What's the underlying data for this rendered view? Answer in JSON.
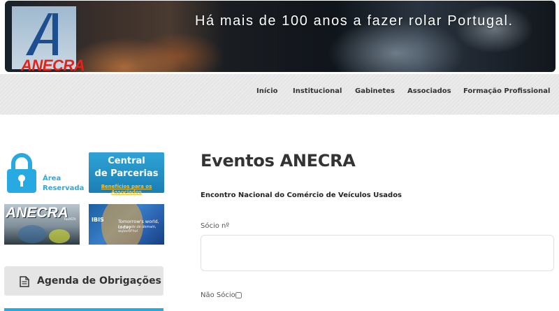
{
  "header": {
    "logo_text": "ANECRA",
    "slogan": "Há mais de 100 anos a fazer rolar Portugal."
  },
  "nav": {
    "items": [
      {
        "label": "Início"
      },
      {
        "label": "Institucional"
      },
      {
        "label": "Gabinetes"
      },
      {
        "label": "Associados"
      },
      {
        "label": "Formação Profissional"
      }
    ]
  },
  "sidebar": {
    "area_reservada": {
      "line1": "Área",
      "line2": "Reservada",
      "icon": "lock-icon"
    },
    "central_parcerias": {
      "line1": "Central",
      "line2": "de Parcerias",
      "tagline": "Benefícios para os Associados"
    },
    "revista": {
      "title": "ANECRA",
      "subtitle": "REVISTA"
    },
    "ibis": {
      "brand": "IBIS",
      "text1": "Tomorrow's world, today",
      "text2": "Le monde de demain, aujourd'hui"
    },
    "agenda": {
      "label": "Agenda de Obrigações",
      "icon": "document-icon"
    }
  },
  "main": {
    "title": "Eventos ANECRA",
    "subtitle": "Encontro Nacional do Comércio de Veículos Usados",
    "socio_label": "Sócio nº",
    "socio_value": "",
    "nao_socio_label": "Não Sócio"
  },
  "colors": {
    "accent": "#29a9e1",
    "logo_red": "#e2231a",
    "central_blue": "#1f8cc4",
    "central_gold": "#f2c23a"
  }
}
